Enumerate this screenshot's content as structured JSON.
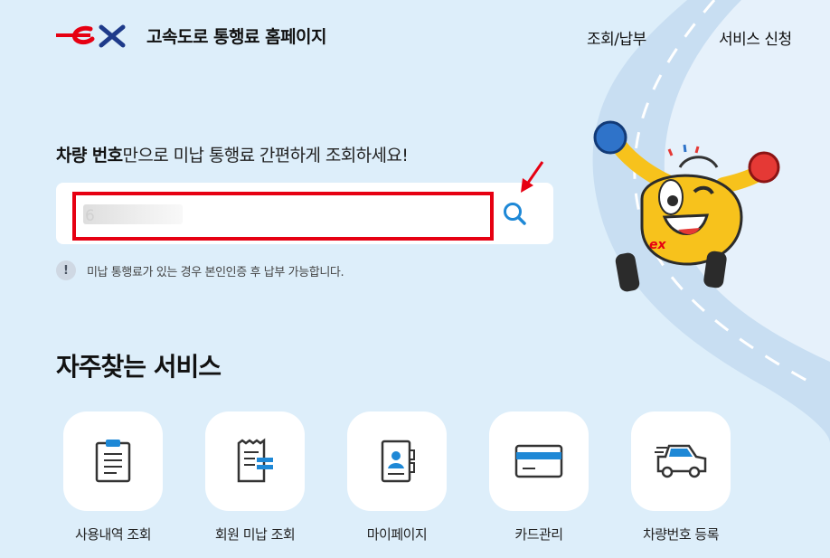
{
  "header": {
    "logo_text": "ex",
    "title": "고속도로 통행료 홈페이지",
    "nav": [
      "조회/납부",
      "서비스 신청"
    ]
  },
  "hero": {
    "headline_bold": "차량 번호",
    "headline_rest": "만으로 미납 통행료 간편하게 조회하세요!",
    "search": {
      "value": "6"
    },
    "notice_icon": "!",
    "notice_text": "미납 통행료가 있는 경우 본인인증 후 납부 가능합니다."
  },
  "services": {
    "title": "자주찾는 서비스",
    "items": [
      {
        "label": "사용내역 조회",
        "icon": "clipboard-icon"
      },
      {
        "label": "회원 미납 조회",
        "icon": "receipt-icon"
      },
      {
        "label": "마이페이지",
        "icon": "id-card-icon"
      },
      {
        "label": "카드관리",
        "icon": "credit-card-icon"
      },
      {
        "label": "차량번호 등록",
        "icon": "car-icon"
      }
    ]
  },
  "colors": {
    "brand_red": "#e60012",
    "accent_blue": "#1e88d6",
    "background": "#ddeefa",
    "mascot_yellow": "#f7c21c"
  }
}
